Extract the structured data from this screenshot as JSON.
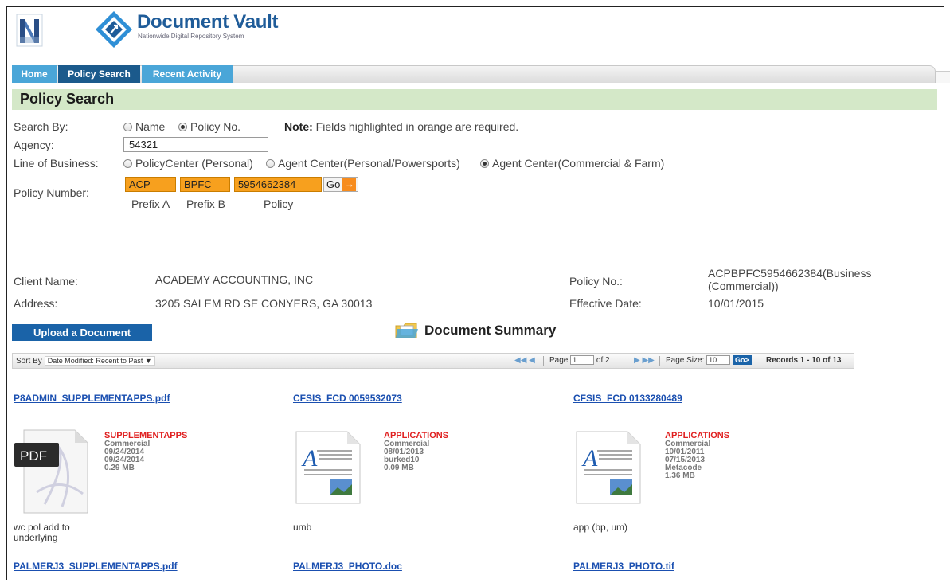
{
  "app": {
    "title": "Document Vault",
    "subtitle": "Nationwide Digital Repository System"
  },
  "tabs": [
    {
      "label": "Home"
    },
    {
      "label": "Policy Search"
    },
    {
      "label": "Recent Activity"
    }
  ],
  "page": {
    "title": "Policy Search"
  },
  "form": {
    "search_by_label": "Search By:",
    "search_by_options": [
      "Name",
      "Policy No."
    ],
    "search_by_selected": "Policy No.",
    "note_bold": "Note:",
    "note_text": " Fields highlighted in orange are required.",
    "agency_label": "Agency:",
    "agency_value": "54321",
    "lob_label": "Line of Business:",
    "lob_options": [
      "PolicyCenter (Personal)",
      "Agent Center(Personal/Powersports)",
      "Agent Center(Commercial & Farm)"
    ],
    "lob_selected": "Agent Center(Commercial & Farm)",
    "policy_number_label": "Policy Number:",
    "prefix_a_value": "ACP",
    "prefix_b_value": "BPFC",
    "policy_value": "5954662384",
    "go_label": "Go",
    "prefix_a_label": "Prefix A",
    "prefix_b_label": "Prefix B",
    "policy_label": "Policy"
  },
  "client": {
    "name_label": "Client Name:",
    "name_value": "ACADEMY ACCOUNTING, INC",
    "address_label": "Address:",
    "address_value": "3205 SALEM RD SE  CONYERS, GA 30013",
    "policy_no_label": "Policy No.:",
    "policy_no_value_line1": "ACPBPFC5954662384(Business",
    "policy_no_value_line2": "(Commercial))",
    "effective_date_label": "Effective Date:",
    "effective_date_value": "10/01/2015"
  },
  "actions": {
    "upload_label": "Upload a Document",
    "summary_title": "Document Summary"
  },
  "grid": {
    "sort_by_label": "Sort By",
    "sort_by_value": "Date Modified: Recent to Past",
    "page_label": "Page",
    "page_value": "1",
    "of_pages": "of 2",
    "page_size_label": "Page Size:",
    "page_size_value": "10",
    "go_label": "Go>",
    "records": "Records 1 - 10 of 13"
  },
  "documents": [
    {
      "name": "P8ADMIN_SUPPLEMENTAPPS.pdf",
      "icon": "pdf-file-icon",
      "icon_text": "PDF",
      "category": "SUPPLEMENTAPPS",
      "line1": "Commercial",
      "line2": "09/24/2014",
      "line3": "09/24/2014",
      "line4": "0.29 MB",
      "desc1": "wc pol add to",
      "desc2": "underlying"
    },
    {
      "name": "CFSIS_FCD 0059532073",
      "icon": "document-file-icon",
      "category": "APPLICATIONS",
      "line1": "Commercial",
      "line2": "08/01/2013",
      "line3": "burked10",
      "line4": "0.09 MB",
      "desc1": "umb",
      "desc2": ""
    },
    {
      "name": "CFSIS_FCD 0133280489",
      "icon": "document-file-icon",
      "category": "APPLICATIONS",
      "line1": "Commercial",
      "line2": "10/01/2011",
      "line3": "07/15/2013",
      "line4": "Metacode",
      "line5": "1.36 MB",
      "desc1": "app (bp, um)",
      "desc2": ""
    },
    {
      "name": "PALMERJ3_SUPPLEMENTAPPS.pdf"
    },
    {
      "name": "PALMERJ3_PHOTO.doc"
    },
    {
      "name": "PALMERJ3_PHOTO.tif"
    }
  ],
  "colors": {
    "tab_active": "#1b5a8c",
    "tab_inactive": "#4aa6d8",
    "section_bar": "#d4e8c8",
    "required_field": "#f7a01e",
    "link": "#1a4fb0",
    "category": "#e02020",
    "primary_button": "#1a63a8"
  }
}
